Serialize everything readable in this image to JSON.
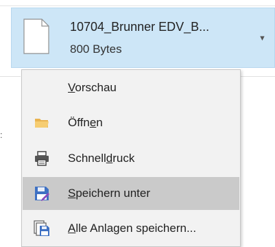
{
  "attachment": {
    "file_name": "10704_Brunner EDV_B...",
    "file_size": "800 Bytes",
    "dropdown_icon": "chevron-down-icon"
  },
  "menu": {
    "items": [
      {
        "label_pre": "",
        "label_mnemonic": "V",
        "label_post": "orschau",
        "icon": null
      },
      {
        "label_pre": "Öffn",
        "label_mnemonic": "e",
        "label_post": "n",
        "icon": "folder-icon"
      },
      {
        "label_pre": "Schnell",
        "label_mnemonic": "d",
        "label_post": "ruck",
        "icon": "printer-icon"
      },
      {
        "label_pre": "",
        "label_mnemonic": "S",
        "label_post": "peichern unter",
        "icon": "save-as-icon"
      },
      {
        "label_pre": "",
        "label_mnemonic": "A",
        "label_post": "lle Anlagen speichern...",
        "icon": "save-all-icon"
      }
    ],
    "highlighted_index": 3
  },
  "colors": {
    "attachment_bg": "#cde6f7",
    "menu_bg": "#f2f2f2",
    "highlight_bg": "#cacaca",
    "folder": "#f3c466",
    "save_blue": "#3f71c3",
    "save_purple": "#8a4bbd"
  }
}
